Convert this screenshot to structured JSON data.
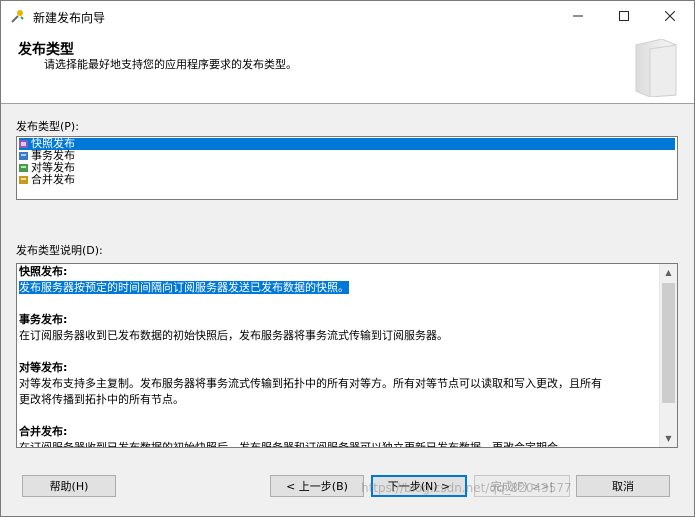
{
  "window": {
    "title": "新建发布向导"
  },
  "header": {
    "title": "发布类型",
    "subtitle": "请选择能最好地支持您的应用程序要求的发布类型。"
  },
  "publication_type": {
    "label": "发布类型(P):",
    "items": [
      {
        "label": "快照发布",
        "icon": "snapshot-icon",
        "selected": true
      },
      {
        "label": "事务发布",
        "icon": "transaction-icon",
        "selected": false
      },
      {
        "label": "对等发布",
        "icon": "peer-to-peer-icon",
        "selected": false
      },
      {
        "label": "合并发布",
        "icon": "merge-icon",
        "selected": false
      }
    ]
  },
  "description": {
    "label": "发布类型说明(D):",
    "sections": [
      {
        "title": "快照发布:",
        "lines": [
          "发布服务器按预定的时间间隔向订阅服务器发送已发布数据的快照。"
        ]
      },
      {
        "title": "事务发布:",
        "lines": [
          "在订阅服务器收到已发布数据的初始快照后，发布服务器将事务流式传输到订阅服务器。"
        ]
      },
      {
        "title": "对等发布:",
        "lines": [
          "对等发布支持多主复制。发布服务器将事务流式传输到拓扑中的所有对等方。所有对等节点可以读取和写入更改，且所有",
          "更改将传播到拓扑中的所有节点。"
        ]
      },
      {
        "title": "合并发布:",
        "lines": [
          "在订阅服务器收到已发布数据的初始快照后，发布服务器和订阅服务器可以独立更新已发布数据。更改会定期合"
        ]
      }
    ]
  },
  "buttons": {
    "help": "帮助(H)",
    "back": "< 上一步(B)",
    "next": "下一步(N) >",
    "finish": "完成(F) >>|",
    "cancel": "取消"
  },
  "watermark": "https://blog.csdn.net/qq_82043577"
}
